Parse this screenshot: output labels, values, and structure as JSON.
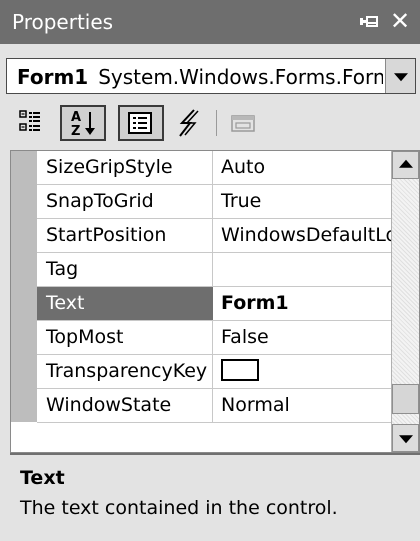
{
  "window": {
    "title": "Properties",
    "pin_icon": "pin-icon",
    "close_icon": "close-icon",
    "close_glyph": "✕"
  },
  "object_selector": {
    "object_name": "Form1",
    "object_type": "System.Windows.Forms.Form"
  },
  "toolbar": {
    "buttons": [
      {
        "name": "categorized-button",
        "icon": "categorized-icon",
        "pressed": false
      },
      {
        "name": "alphabetical-button",
        "icon": "sort-az-icon",
        "pressed": true
      },
      {
        "name": "properties-button",
        "icon": "properties-list-icon",
        "pressed": true
      },
      {
        "name": "events-button",
        "icon": "lightning-icon",
        "pressed": false
      },
      {
        "name": "property-pages-button",
        "icon": "property-pages-icon",
        "pressed": false,
        "disabled": true
      }
    ]
  },
  "grid": {
    "rows": [
      {
        "name": "SizeGripStyle",
        "value": "Auto"
      },
      {
        "name": "SnapToGrid",
        "value": "True"
      },
      {
        "name": "StartPosition",
        "value": "WindowsDefaultLocation"
      },
      {
        "name": "Tag",
        "value": ""
      },
      {
        "name": "Text",
        "value": "Form1",
        "selected": true,
        "bold": true
      },
      {
        "name": "TopMost",
        "value": "False"
      },
      {
        "name": "TransparencyKey",
        "value": "",
        "swatch": "#ffffff"
      },
      {
        "name": "WindowState",
        "value": "Normal"
      }
    ],
    "scroll_position": 0.92
  },
  "description": {
    "title": "Text",
    "text": "The text contained in the control."
  },
  "colors": {
    "titlebar": "#6e6e6e",
    "selected_row": "#6e6e6e",
    "panel": "#e3e3e3",
    "gutter": "#bdbdbd"
  }
}
